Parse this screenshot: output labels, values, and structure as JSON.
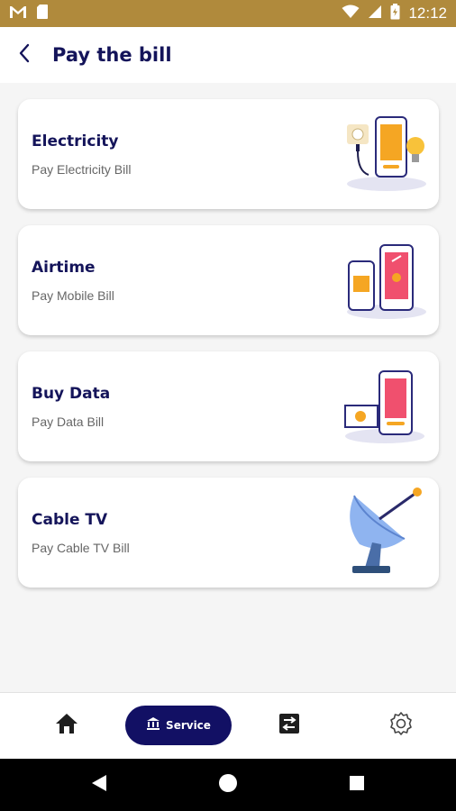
{
  "status_bar": {
    "time": "12:12",
    "icons": [
      "gmail-icon",
      "sim-card-icon",
      "wifi-icon",
      "signal-icon",
      "battery-icon"
    ]
  },
  "header": {
    "back_icon": "chevron-left-icon",
    "title": "Pay the bill"
  },
  "services": [
    {
      "title": "Electricity",
      "subtitle": "Pay Electricity Bill",
      "icon": "electricity-illustration"
    },
    {
      "title": "Airtime",
      "subtitle": "Pay Mobile Bill",
      "icon": "airtime-illustration"
    },
    {
      "title": "Buy Data",
      "subtitle": "Pay Data Bill",
      "icon": "data-illustration"
    },
    {
      "title": "Cable TV",
      "subtitle": "Pay Cable TV Bill",
      "icon": "satellite-dish-illustration"
    }
  ],
  "bottom_nav": {
    "items": [
      {
        "icon": "home-icon"
      },
      {
        "label": "Service",
        "icon": "bank-icon",
        "active": true
      },
      {
        "icon": "transfer-icon"
      },
      {
        "icon": "settings-icon"
      }
    ]
  },
  "colors": {
    "primary": "#14145a",
    "status_bar": "#b08a3c",
    "accent_orange": "#f5a623",
    "accent_pink": "#f0506e",
    "background": "#f5f5f5"
  }
}
